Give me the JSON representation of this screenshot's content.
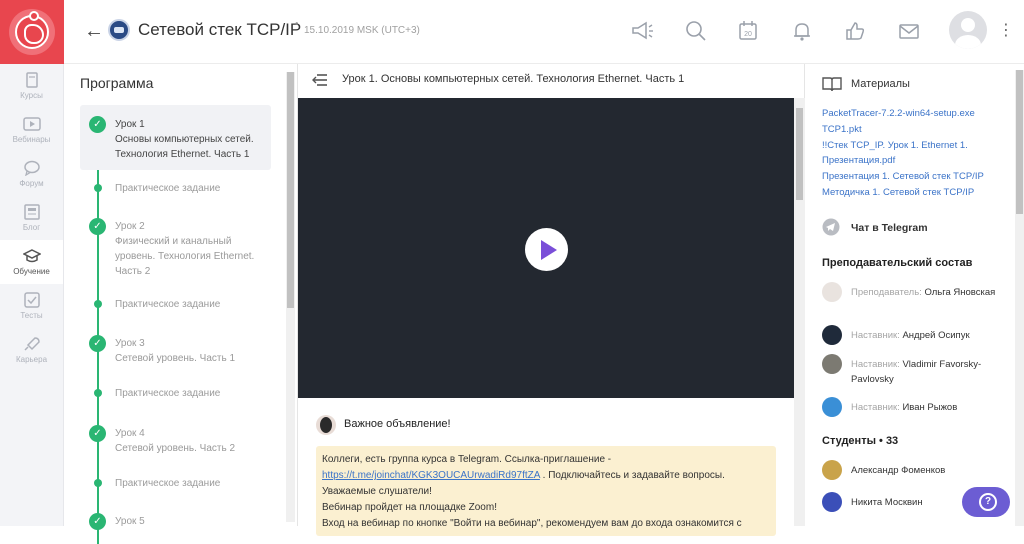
{
  "header": {
    "title": "Сетевой стек TCP/IP",
    "separator": "•",
    "date": "15.10.2019 MSK (UTC+3)",
    "calendar_day": "20"
  },
  "rail": [
    {
      "label": "Курсы",
      "icon": "book-icon"
    },
    {
      "label": "Вебинары",
      "icon": "play-icon"
    },
    {
      "label": "Форум",
      "icon": "chat-bubble-icon"
    },
    {
      "label": "Блог",
      "icon": "newspaper-icon"
    },
    {
      "label": "Обучение",
      "icon": "graduation-cap-icon",
      "active": true
    },
    {
      "label": "Тесты",
      "icon": "checkbox-icon"
    },
    {
      "label": "Карьера",
      "icon": "rocket-icon"
    }
  ],
  "program": {
    "title": "Программа",
    "items": [
      {
        "title": "Урок 1",
        "subtitle": "Основы компьютерных сетей. Технология Ethernet. Часть 1",
        "type": "lesson",
        "active": true
      },
      {
        "title": "Практическое задание",
        "type": "task"
      },
      {
        "title": "Урок 2",
        "subtitle": "Физический и канальный уровень. Технология Ethernet. Часть 2",
        "type": "lesson"
      },
      {
        "title": "Практическое задание",
        "type": "task"
      },
      {
        "title": "Урок 3",
        "subtitle": "Сетевой уровень. Часть 1",
        "type": "lesson"
      },
      {
        "title": "Практическое задание",
        "type": "task"
      },
      {
        "title": "Урок 4",
        "subtitle": "Сетевой уровень. Часть 2",
        "type": "lesson"
      },
      {
        "title": "Практическое задание",
        "type": "task"
      },
      {
        "title": "Урок 5",
        "subtitle": "",
        "type": "lesson"
      }
    ]
  },
  "lesson": {
    "title": "Урок 1. Основы компьютерных сетей. Технология Ethernet. Часть 1"
  },
  "announcement": {
    "title": "Важное объявление!",
    "line1": "Коллеги, есть группа курса в Telegram. Ссылка-приглашение -",
    "link": "https://t.me/joinchat/KGK3OUCAUrwadiRd97ftZA",
    "line2": ". Подключайтесь и задавайте вопросы.",
    "line3": "Уважаемые слушатели!",
    "line4": "Вебинар пройдет на площадке Zoom!",
    "line5": "Вход на вебинар по кнопке \"Войти на вебинар\", рекомендуем вам до входа ознакомится с"
  },
  "materials": {
    "title": "Материалы",
    "files": [
      "PacketTracer-7.2.2-win64-setup.exe",
      "TCP1.pkt",
      "!!Стек TCP_IP. Урок 1. Ethernet 1.",
      "Презентация.pdf",
      "Презентация 1. Сетевой стек TCP/IP",
      "Методичка 1. Сетевой стек TCP/IP"
    ]
  },
  "telegram": {
    "label": "Чат в Telegram"
  },
  "staff": {
    "title": "Преподавательский состав",
    "people": [
      {
        "role": "Преподаватель:",
        "name": "Ольга Яновская"
      },
      {
        "role": "Наставник:",
        "name": "Андрей Осипук"
      },
      {
        "role": "Наставник:",
        "name": "Vladimir Favorsky-Pavlovsky"
      },
      {
        "role": "Наставник:",
        "name": "Иван Рыжов"
      }
    ]
  },
  "students": {
    "title": "Студенты • 33",
    "people": [
      {
        "name": "Александр Фоменков"
      },
      {
        "name": "Никита Москвин"
      }
    ]
  },
  "colors": {
    "brand": "#e8464e",
    "success": "#2ab673",
    "link": "#3b73c8",
    "accent": "#6c5dd3",
    "video_bg": "#232830",
    "notice_bg": "#fbf0d1"
  }
}
